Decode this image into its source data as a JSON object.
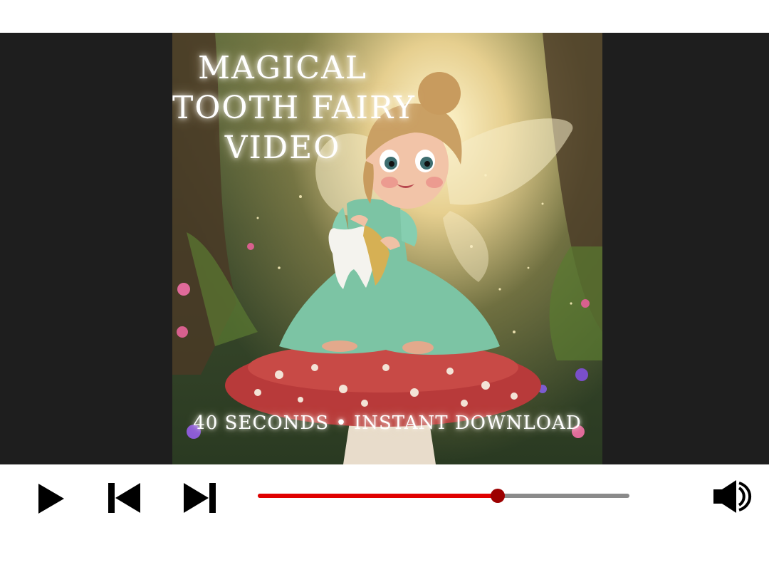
{
  "video": {
    "title_lines": [
      "MAGICAL",
      "TOOTH FAIRY",
      "VIDEO"
    ],
    "subtitle": "40 SECONDS • INSTANT DOWNLOAD"
  },
  "player": {
    "progress_fraction": 0.645,
    "accent_color": "#e00000",
    "track_color": "#8a8a8a",
    "icons": [
      "play-icon",
      "skip-previous-icon",
      "skip-next-icon",
      "volume-icon"
    ]
  }
}
